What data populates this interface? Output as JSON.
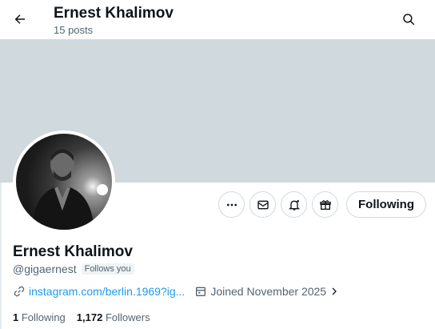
{
  "header": {
    "title": "Ernest Khalimov",
    "posts": "15 posts"
  },
  "icons": {
    "back": "arrow-left-icon",
    "search": "search-icon",
    "more": "more-icon",
    "message": "message-icon",
    "notifications": "bell-plus-icon",
    "gift": "gift-icon",
    "link": "link-icon",
    "calendar": "calendar-icon",
    "chevron": "chevron-right-icon"
  },
  "colors": {
    "banner": "#cfd9de",
    "link": "#1d9bf0",
    "muted": "#536471"
  },
  "actions": {
    "following_label": "Following"
  },
  "profile": {
    "name": "Ernest Khalimov",
    "handle": "@gigaernest",
    "follows_you": "Follows you",
    "link_text": "instagram.com/berlin.1969?ig...",
    "joined": "Joined November 2025"
  },
  "stats": {
    "following_count": "1",
    "following_label": "Following",
    "followers_count": "1,172",
    "followers_label": "Followers"
  }
}
